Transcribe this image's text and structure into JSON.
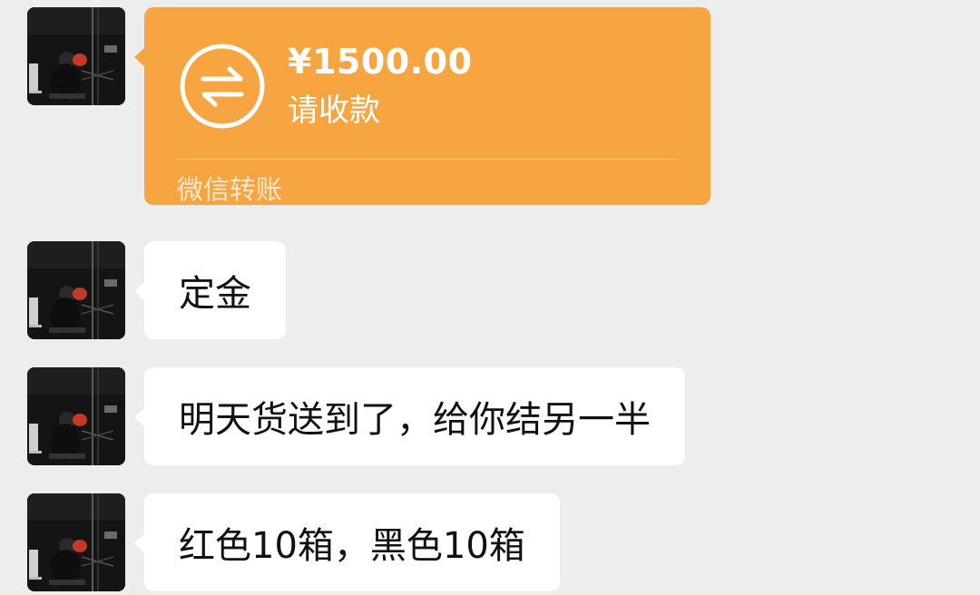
{
  "messages": [
    {
      "type": "transfer",
      "amount": "¥1500.00",
      "status": "请收款",
      "footer": "微信转账",
      "icon": "transfer-arrows-icon"
    },
    {
      "type": "text",
      "text": "定金"
    },
    {
      "type": "text",
      "text": "明天货送到了，给你结另一半"
    },
    {
      "type": "text",
      "text": "红色10箱，黑色10箱"
    }
  ],
  "colors": {
    "background": "#ededed",
    "bubble": "#ffffff",
    "transfer": "#f7a540"
  }
}
